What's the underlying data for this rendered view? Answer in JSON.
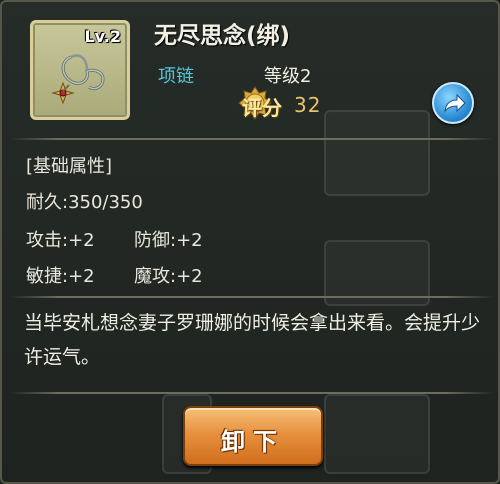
{
  "item": {
    "level_badge": "Lv.2",
    "name": "无尽思念(绑)",
    "type": "项链",
    "level": "等级2",
    "score_label": "评分",
    "score_value": "32",
    "icon": "necklace-icon"
  },
  "attributes": {
    "section_title": "[基础属性]",
    "durability": "耐久:350/350",
    "attack": "攻击:+2",
    "defense": "防御:+2",
    "agility": "敏捷:+2",
    "magic_attack": "魔攻:+2"
  },
  "description": "当毕安札想念妻子罗珊娜的时候会拿出来看。会提升少许运气。",
  "buttons": {
    "unequip": "卸下",
    "share_icon": "share-arrow-icon"
  },
  "colors": {
    "item_type": "#54c6d8",
    "score": "#e7c36a",
    "button": "#e8913e",
    "share": "#2f8fd6"
  }
}
